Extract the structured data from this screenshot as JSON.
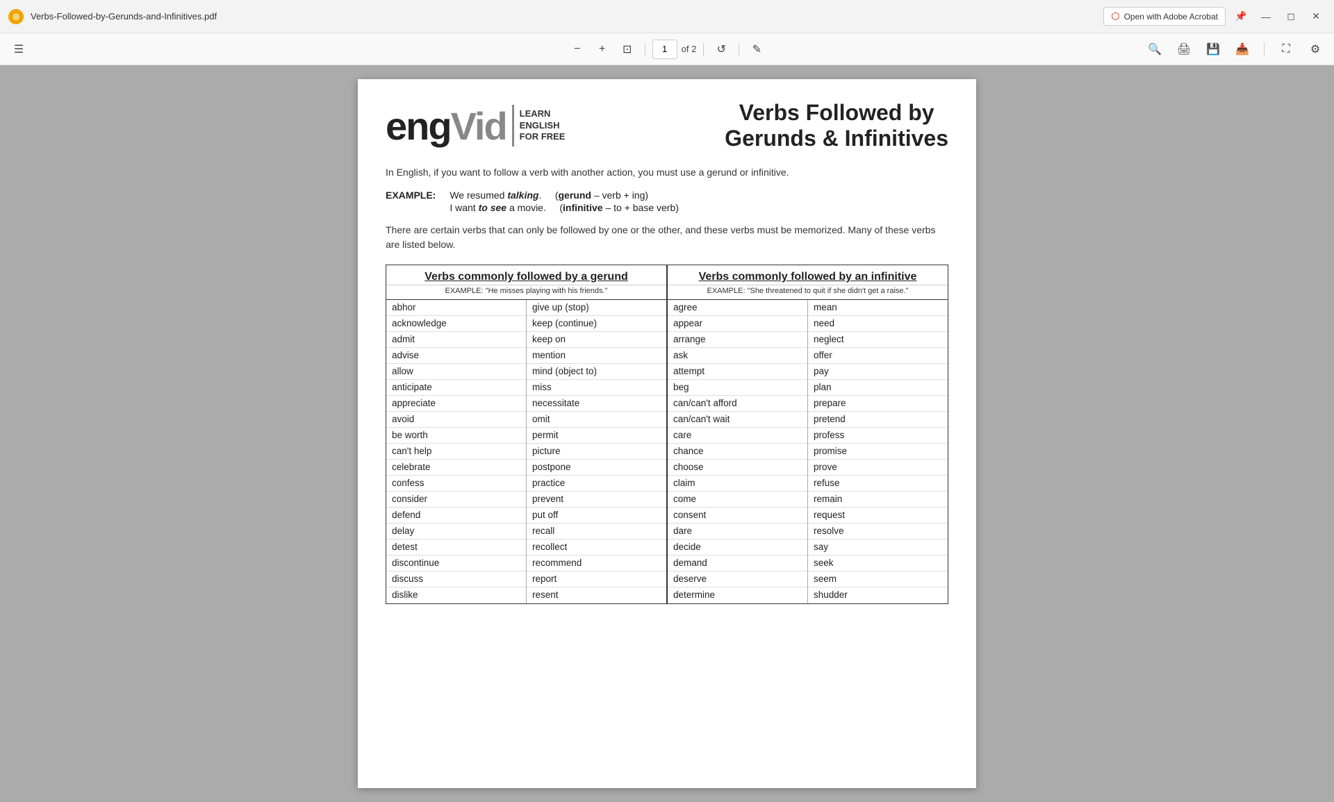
{
  "titleBar": {
    "icon": "PDF",
    "filename": "Verbs-Followed-by-Gerunds-and-Infinitives.pdf",
    "openAcrobat": "Open with Adobe Acrobat",
    "pinTitle": "Pin tab",
    "minimizeTitle": "Minimize",
    "maximizeTitle": "Maximize",
    "closeTitle": "Close"
  },
  "toolbar": {
    "zoomOut": "−",
    "zoomIn": "+",
    "fitPage": "⊡",
    "currentPage": "1",
    "totalPages": "of 2",
    "rotate": "↺",
    "draw": "✎",
    "searchTitle": "Search",
    "printTitle": "Print",
    "saveTitle": "Save",
    "saveAsTitle": "Save As",
    "fullscreenTitle": "Full Screen",
    "settingsTitle": "Settings"
  },
  "pdf": {
    "logo": {
      "eng": "eng",
      "vid": "Vid",
      "lines": [
        "LEARN",
        "ENGLISH",
        "FOR FREE"
      ]
    },
    "title": {
      "line1": "Verbs Followed by",
      "line2": "Gerunds & Infinitives"
    },
    "intro": "In English, if you want to follow a verb with another action, you must use a gerund or infinitive.",
    "exampleLabel": "EXAMPLE:",
    "exampleLine1": "We resumed ",
    "exampleLine1italic": "talking",
    "exampleLine1end": ".",
    "exampleLine2start": "I want ",
    "exampleLine2italic": "to see",
    "exampleLine2end": " a movie.",
    "gerundDef": "(gerund – verb + ing)",
    "infinitiveDef": "(infinitive – to + base verb)",
    "memoText": "There are certain verbs that can only be followed by one or the other, and these verbs must be memorized. Many of these verbs are listed below.",
    "gerundTable": {
      "heading": "Verbs commonly followed by a gerund",
      "example": "EXAMPLE: \"He misses playing with his friends.\"",
      "col1": [
        "abhor",
        "acknowledge",
        "admit",
        "advise",
        "allow",
        "anticipate",
        "appreciate",
        "avoid",
        "be worth",
        "can't help",
        "celebrate",
        "confess",
        "consider",
        "defend",
        "delay",
        "detest",
        "discontinue",
        "discuss",
        "dislike"
      ],
      "col2": [
        "give up (stop)",
        "keep (continue)",
        "keep on",
        "mention",
        "mind (object to)",
        "miss",
        "necessitate",
        "omit",
        "permit",
        "picture",
        "postpone",
        "practice",
        "prevent",
        "put off",
        "recall",
        "recollect",
        "recommend",
        "report",
        "resent"
      ]
    },
    "infinitiveTable": {
      "heading": "Verbs commonly followed by an infinitive",
      "example": "EXAMPLE: \"She threatened to quit if she didn't get a raise.\"",
      "col1": [
        "agree",
        "appear",
        "arrange",
        "ask",
        "attempt",
        "beg",
        "can/can't afford",
        "can/can't wait",
        "care",
        "chance",
        "choose",
        "claim",
        "come",
        "consent",
        "dare",
        "decide",
        "demand",
        "deserve",
        "determine"
      ],
      "col2": [
        "mean",
        "need",
        "neglect",
        "offer",
        "pay",
        "plan",
        "prepare",
        "pretend",
        "profess",
        "promise",
        "prove",
        "refuse",
        "remain",
        "request",
        "resolve",
        "say",
        "seek",
        "seem",
        "shudder"
      ]
    }
  }
}
